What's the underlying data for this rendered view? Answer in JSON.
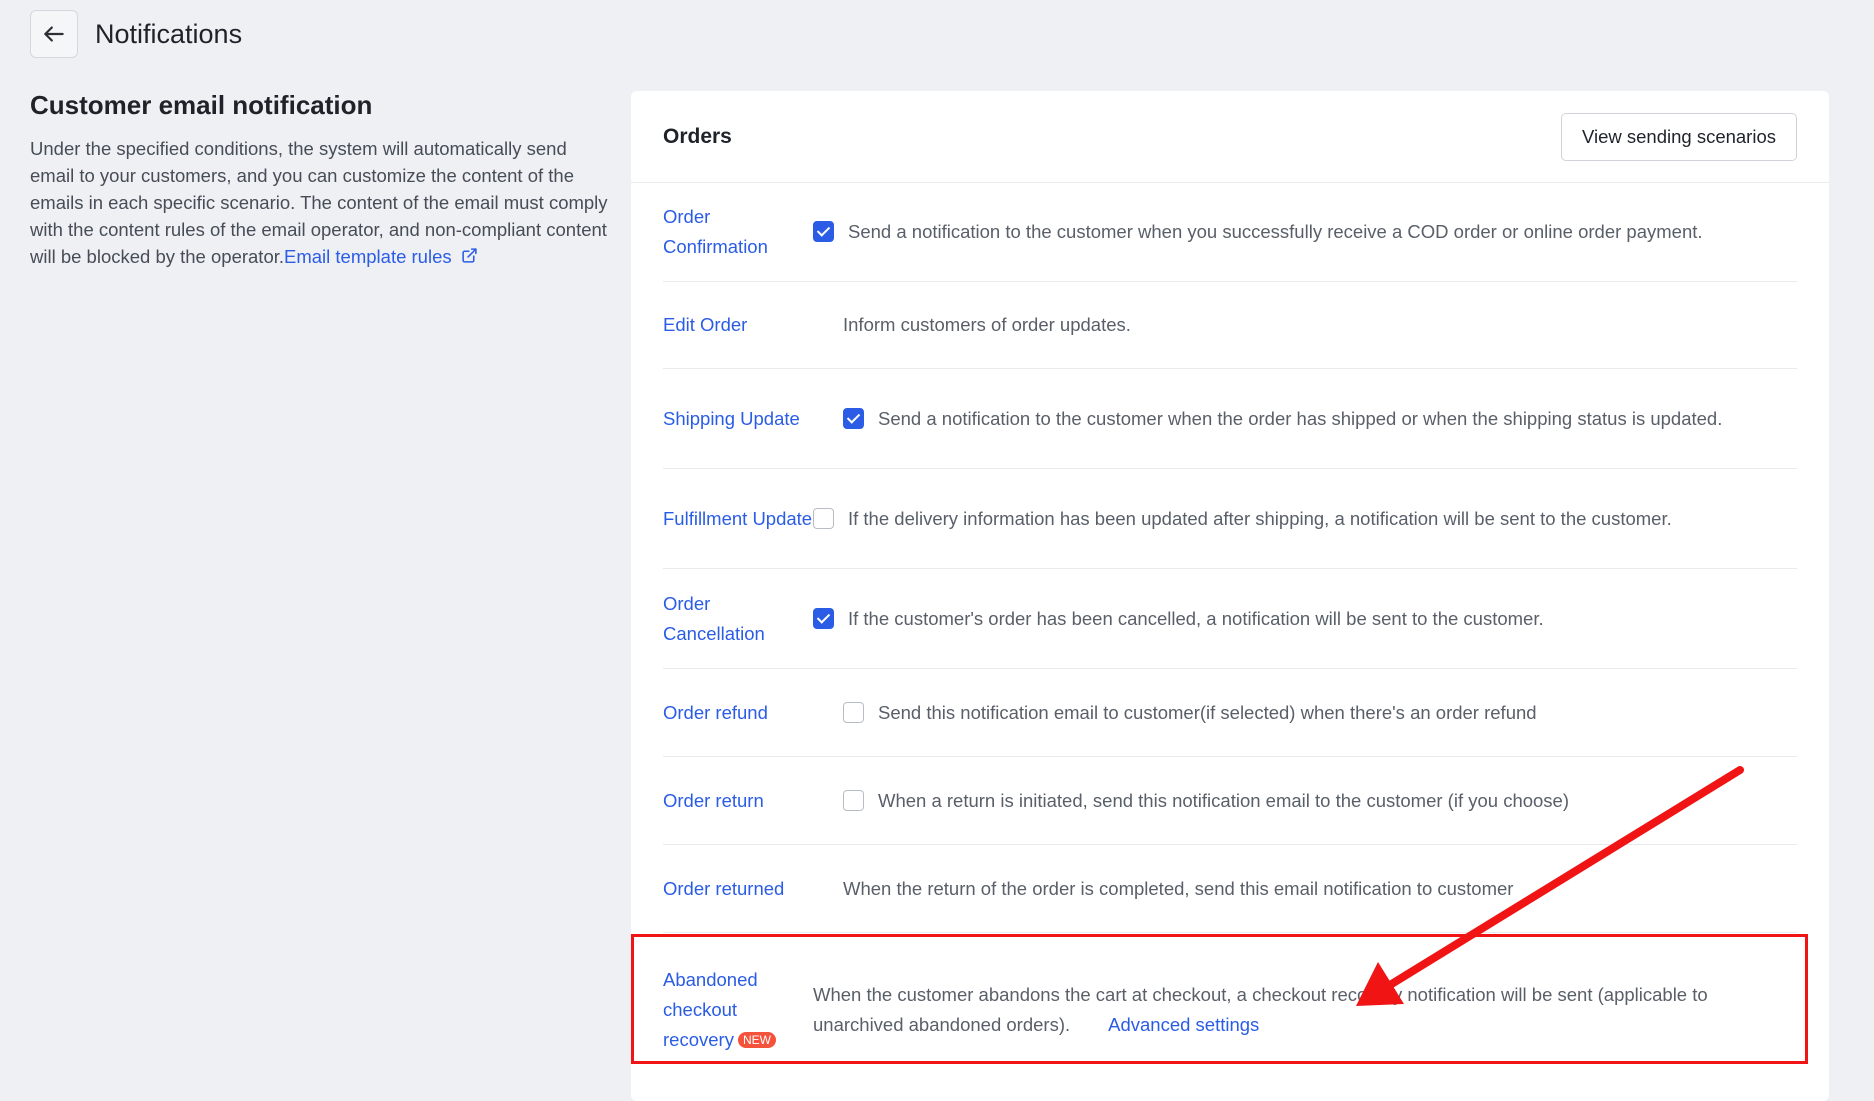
{
  "header": {
    "title": "Notifications"
  },
  "intro": {
    "title": "Customer email notification",
    "description": "Under the specified conditions, the system will automatically send email to your customers, and you can customize the content of the emails in each specific scenario. The content of the email must comply with the content rules of the email operator, and non-compliant content will be blocked by the operator.",
    "rules_link": "Email template rules"
  },
  "card": {
    "title": "Orders",
    "scenarios_button": "View sending scenarios",
    "rows": [
      {
        "name": "Order Confirmation",
        "checkbox": "checked",
        "desc": "Send a notification to the customer when you successfully receive a COD order or online order payment."
      },
      {
        "name": "Edit Order",
        "checkbox": "none",
        "desc": "Inform customers of order updates."
      },
      {
        "name": "Shipping Update",
        "checkbox": "checked",
        "desc": "Send a notification to the customer when the order has shipped or when the shipping status is updated."
      },
      {
        "name": "Fulfillment Update",
        "checkbox": "unchecked",
        "desc": "If the delivery information has been updated after shipping, a notification will be sent to the customer."
      },
      {
        "name": "Order Cancellation",
        "checkbox": "checked",
        "desc": "If the customer's order has been cancelled, a notification will be sent to the customer."
      },
      {
        "name": "Order refund",
        "checkbox": "unchecked",
        "desc": "Send this notification email to customer(if selected) when there's an order refund"
      },
      {
        "name": "Order return",
        "checkbox": "unchecked",
        "desc": "When a return is initiated, send this notification email to the customer (if you choose)"
      },
      {
        "name": "Order returned",
        "checkbox": "none",
        "desc": "When the return of the order is completed, send this email notification to customer"
      },
      {
        "name": "Abandoned checkout recovery",
        "checkbox": "none",
        "badge": "NEW",
        "desc": "When the customer abandons the cart at checkout, a checkout recovery notification will be sent (applicable to unarchived abandoned orders).",
        "link": "Advanced settings"
      }
    ]
  },
  "annotation": {
    "color": "#f01414"
  },
  "colors": {
    "accent": "#2a5ce6",
    "badge": "#f5523b",
    "background": "#eef0f4"
  }
}
